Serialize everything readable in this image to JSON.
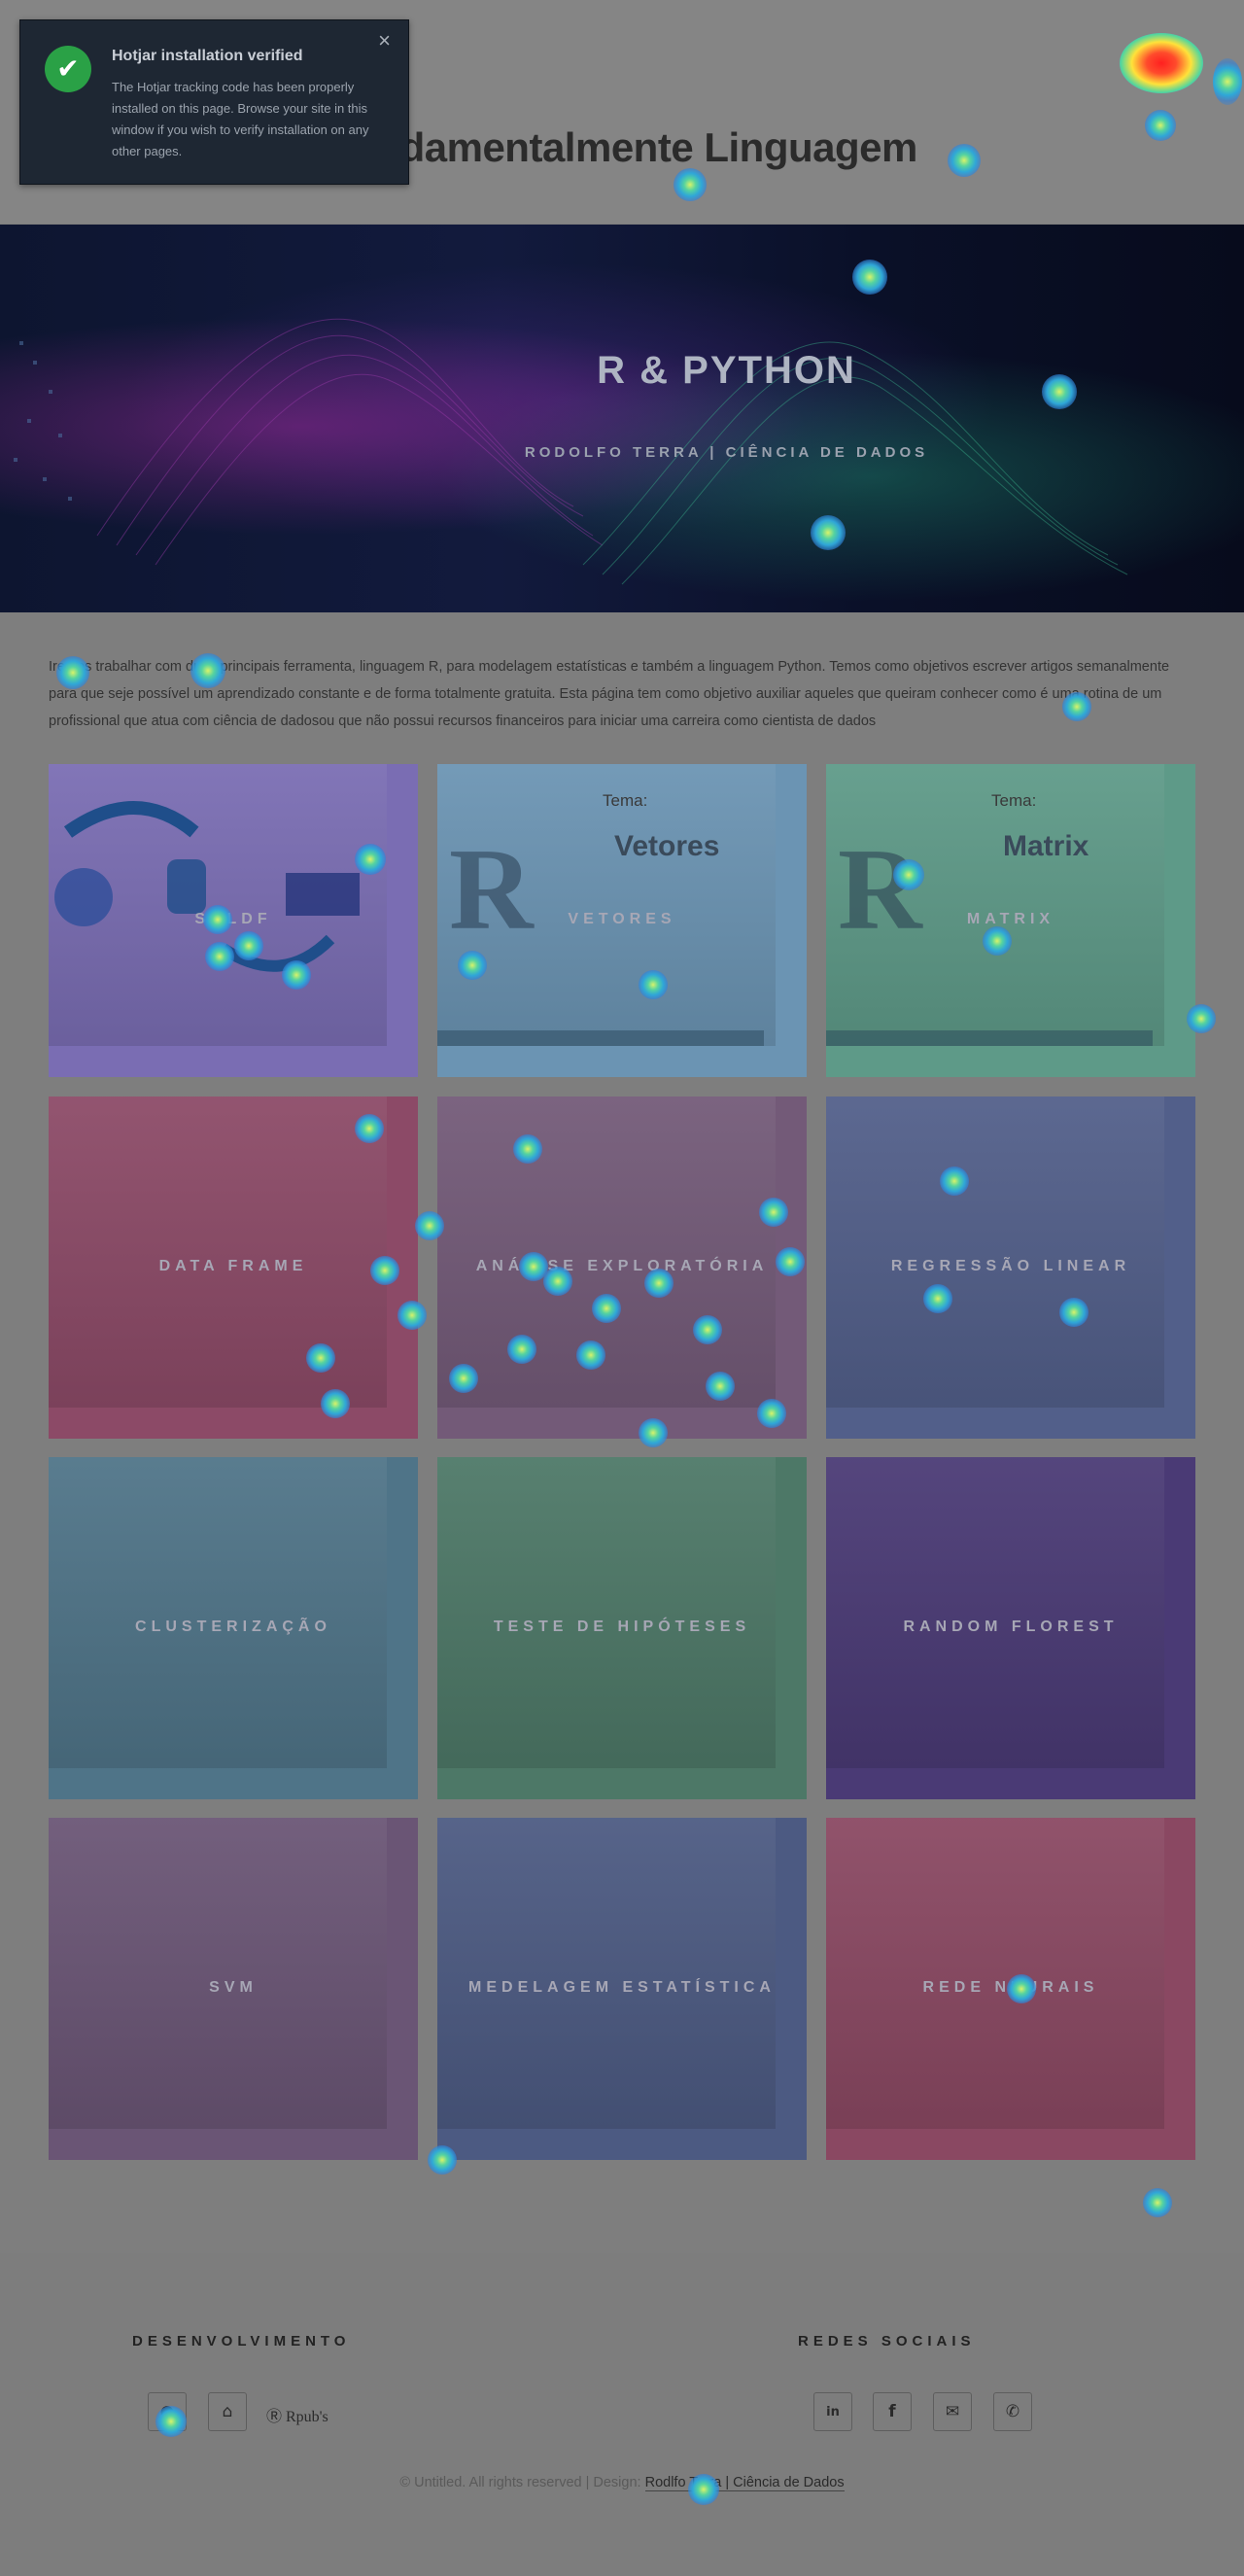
{
  "header": {
    "title": "Fundamentalmente Linguagem"
  },
  "toast": {
    "title": "Hotjar installation verified",
    "body": "The Hotjar tracking code has been properly installed on this page. Browse your site in this window if you wish to verify installation on any other pages.",
    "close_glyph": "×",
    "check_glyph": "✔"
  },
  "hero": {
    "title": "R   &   PYTHON",
    "subtitle": "RODOLFO TERRA | CIÊNCIA DE DADOS"
  },
  "intro": {
    "text": "Iremos trabalhar com duas principais ferramenta, linguagem R, para modelagem estatísticas e também a linguagem Python. Temos como objetivos escrever artigos semanalmente para que seje possível um aprendizado constante e de forma totalmente gratuita. Esta página tem como objetivo auxiliar aqueles que queiram conhecer como é uma rotina de um profissional que atua com ciência de dadosou que não possui recursos financeiros para iniciar uma carreira como cientista de dados"
  },
  "cards": [
    {
      "label": "SQLDF",
      "color": "#7a6db3",
      "thumb": "sqldf"
    },
    {
      "label": "VETORES",
      "color": "#6b94b3",
      "thumb": "vetores",
      "tema": "Tema:",
      "word": "Vetores"
    },
    {
      "label": "MATRIX",
      "color": "#5e9a88",
      "thumb": "matrix",
      "tema": "Tema:",
      "word": "Matrix"
    },
    {
      "label": "DATA FRAME",
      "color": "#8c4a67"
    },
    {
      "label": "ANÁLISE EXPLORATÓRIA",
      "color": "#735a78"
    },
    {
      "label": "REGRESSÃO LINEAR",
      "color": "#525f8a"
    },
    {
      "label": "CLUSTERIZAÇÃO",
      "color": "#4f7488"
    },
    {
      "label": "TESTE DE HIPÓTESES",
      "color": "#4d7867"
    },
    {
      "label": "RANDOM FLOREST",
      "color": "#4a3a75"
    },
    {
      "label": "SVM",
      "color": "#6a5575"
    },
    {
      "label": "MEDELAGEM ESTATÍSTICA",
      "color": "#4c5a82"
    },
    {
      "label": "REDE NEURAIS",
      "color": "#8a4862"
    }
  ],
  "footer": {
    "dev_heading": "DESENVOLVIMENTO",
    "social_heading": "REDES SOCIAIS",
    "dev_links": [
      {
        "icon": "github-icon",
        "glyph": "●"
      },
      {
        "icon": "home-icon",
        "glyph": "⌂"
      }
    ],
    "rpubs_label": "Ⓡ Rpub's",
    "social": [
      {
        "icon": "linkedin-icon",
        "glyph": "in"
      },
      {
        "icon": "facebook-icon",
        "glyph": "f"
      },
      {
        "icon": "email-icon",
        "glyph": "✉"
      },
      {
        "icon": "phone-icon",
        "glyph": "✆"
      }
    ],
    "copyright_prefix": "© Untitled. All rights reserved | Design: ",
    "copyright_link": "Rodlfo Terra | Ciência de Dados"
  }
}
